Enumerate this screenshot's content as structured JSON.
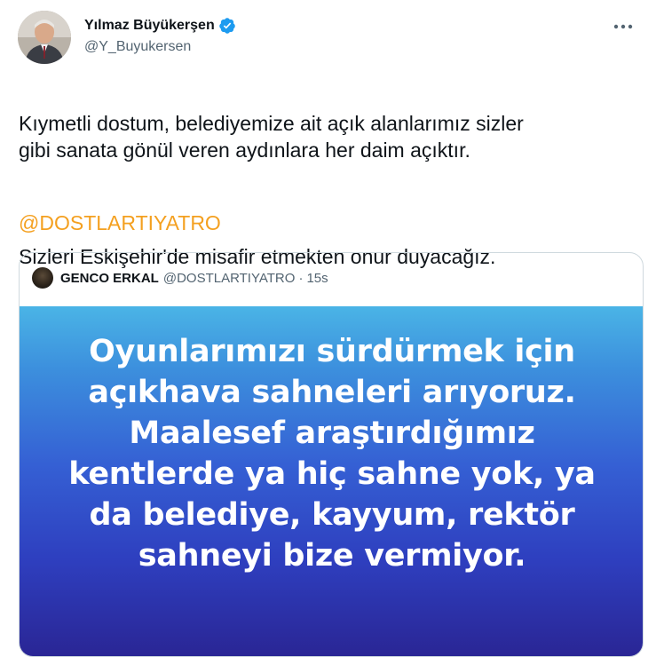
{
  "author": {
    "display_name": "Yılmaz Büyükerşen",
    "handle": "@Y_Buyukersen",
    "verified_icon": "verified-badge-icon",
    "more_icon": "more-options-icon"
  },
  "tweet": {
    "paragraph1": "Kıymetli dostum, belediyemize ait açık alanlarımız sizler\ngibi sanata gönül veren aydınlara her daim açıktır.",
    "paragraph2": "Sizleri Eskişehir'de misafir etmekten onur duyacağız.",
    "mention": "@DOSTLARTIYATRO",
    "mention_color": "#f4a020"
  },
  "quoted_tweet": {
    "display_name": "GENCO ERKAL",
    "handle": "@DOSTLARTIYATRO",
    "separator": "·",
    "time": "15s",
    "image_text": "Oyunlarımızı sürdürmek için\naçıkhava sahneleri arıyoruz.\nMaalesef araştırdığımız\nkentlerde ya hiç sahne yok, ya\nda belediye, kayyum, rektör\nsahneyi bize vermiyor.",
    "image_gradient": [
      "#4ab4e6",
      "#3560d4",
      "#2a2594"
    ]
  },
  "colors": {
    "verified_blue": "#1d9bf0",
    "secondary_text": "#536471",
    "border": "#cfd9de"
  }
}
